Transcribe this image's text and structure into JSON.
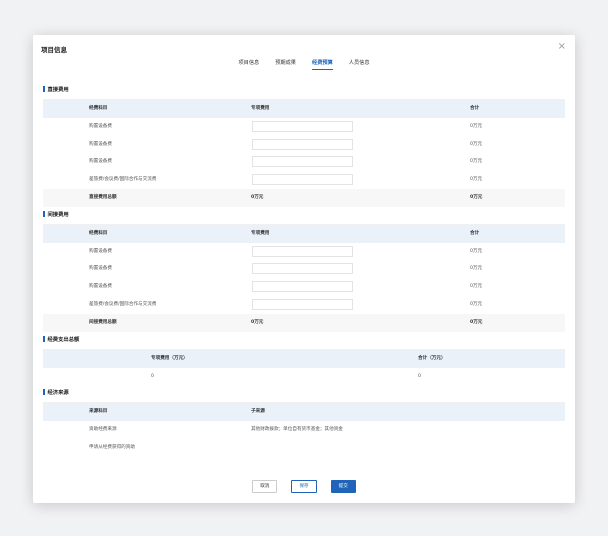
{
  "modal": {
    "title": "项目信息",
    "close": "×"
  },
  "tabs": [
    "项目信息",
    "预期成果",
    "经费预算",
    "人员信息"
  ],
  "direct": {
    "section": "直接费用",
    "headers": [
      "经费科目",
      "专项费用",
      "合计"
    ],
    "rows": [
      {
        "name": "购置设备费",
        "total": "0万元"
      },
      {
        "name": "购置设备费",
        "total": "0万元"
      },
      {
        "name": "购置设备费",
        "total": "0万元"
      },
      {
        "name": "差旅费/会议费/国际合作与交流费",
        "total": "0万元"
      }
    ],
    "summary": {
      "name": "直接费用总额",
      "special": "0万元",
      "total": "0万元"
    }
  },
  "indirect": {
    "section": "间接费用",
    "headers": [
      "经费科目",
      "专项费用",
      "合计"
    ],
    "rows": [
      {
        "name": "购置设备费",
        "total": "0万元"
      },
      {
        "name": "购置设备费",
        "total": "0万元"
      },
      {
        "name": "购置设备费",
        "total": "0万元"
      },
      {
        "name": "差旅费/会议费/国际合作与交流费",
        "total": "0万元"
      }
    ],
    "summary": {
      "name": "间接费用总额",
      "special": "0万元",
      "total": "0万元"
    }
  },
  "expense_total": {
    "section": "经费支出总额",
    "headers": [
      "专项费用（万元）",
      "合计（万元）"
    ],
    "values": [
      "0",
      "0"
    ]
  },
  "funding": {
    "section": "经济来源",
    "headers": [
      "来源科目",
      "子来源"
    ],
    "rows": [
      {
        "name": "资助经费来源",
        "sub": "其他财政拨款；单位自有货币基金；其他资金"
      },
      {
        "name": "申请从经费获得的资助",
        "sub": ""
      }
    ]
  },
  "buttons": {
    "cancel": "取消",
    "save": "保存",
    "submit": "提交"
  }
}
